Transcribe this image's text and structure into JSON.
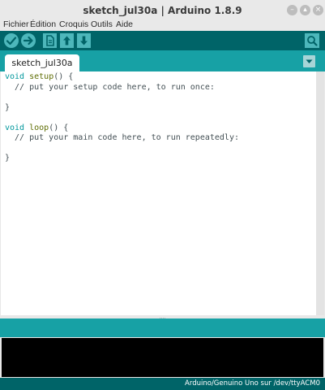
{
  "window": {
    "title": "sketch_jul30a | Arduino 1.8.9",
    "buttons": {
      "minimize": "–",
      "maximize": "▴",
      "close": "×"
    }
  },
  "menubar": {
    "items": [
      {
        "label": "Fichier"
      },
      {
        "label": "Édition"
      },
      {
        "label": "Croquis"
      },
      {
        "label": "Outils"
      },
      {
        "label": "Aide"
      }
    ]
  },
  "toolbar": {
    "buttons": [
      {
        "icon": "verify-check-icon"
      },
      {
        "icon": "upload-arrow-icon"
      },
      {
        "icon": "new-file-icon"
      },
      {
        "icon": "open-up-arrow-icon"
      },
      {
        "icon": "save-down-arrow-icon"
      }
    ],
    "serial_monitor_icon": "magnifier-icon"
  },
  "tabs": {
    "active": "sketch_jul30a",
    "menu_icon": "triangle-down-icon"
  },
  "editor": {
    "lines": [
      [
        {
          "t": "void",
          "c": "kw"
        },
        {
          "t": " ",
          "c": ""
        },
        {
          "t": "setup",
          "c": "fn"
        },
        {
          "t": "() {",
          "c": ""
        }
      ],
      [
        {
          "t": "  // put your setup code here, to run once:",
          "c": ""
        }
      ],
      [
        {
          "t": "",
          "c": ""
        }
      ],
      [
        {
          "t": "}",
          "c": ""
        }
      ],
      [
        {
          "t": "",
          "c": ""
        }
      ],
      [
        {
          "t": "void",
          "c": "kw"
        },
        {
          "t": " ",
          "c": ""
        },
        {
          "t": "loop",
          "c": "fn"
        },
        {
          "t": "() {",
          "c": ""
        }
      ],
      [
        {
          "t": "  // put your main code here, to run repeatedly:",
          "c": ""
        }
      ],
      [
        {
          "t": "",
          "c": ""
        }
      ],
      [
        {
          "t": "}",
          "c": ""
        }
      ]
    ]
  },
  "status": {
    "grip": "....",
    "board": "Arduino/Genuino Uno sur /dev/ttyACM0"
  },
  "colors": {
    "toolbar": "#006468",
    "tabbar": "#17a1a5",
    "button": "#4db7bb",
    "keyword": "#00979c",
    "function": "#5e6d03"
  }
}
